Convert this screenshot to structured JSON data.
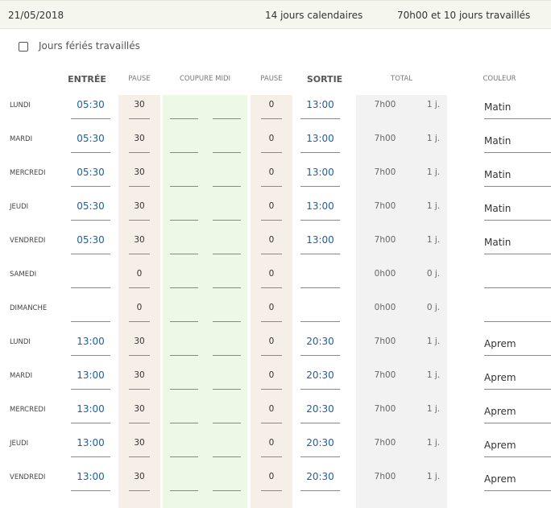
{
  "header": {
    "date": "21/05/2018",
    "calendar_days": "14 jours calendaires",
    "worked_summary": "70h00 et 10 jours travaillés"
  },
  "holidays_checkbox": {
    "label": "Jours fériés travaillés",
    "checked": false
  },
  "columns": {
    "entree": "ENTRÉE",
    "pause1": "PAUSE",
    "coupure": "COUPURE MIDI",
    "pause2": "PAUSE",
    "sortie": "SORTIE",
    "total": "TOTAL",
    "couleur": "COULEUR"
  },
  "colors": {
    "pause_band": "#f5efe7",
    "coupure_band": "#eef8e6",
    "total_band": "#f2f2f2",
    "time_blue": "#1e5fa0"
  },
  "rows": [
    {
      "day": "LUNDI",
      "entree": "05:30",
      "pause1": "30",
      "pause2": "0",
      "sortie": "13:00",
      "total": "7h00",
      "days": "1 j.",
      "couleur": "Matin"
    },
    {
      "day": "MARDI",
      "entree": "05:30",
      "pause1": "30",
      "pause2": "0",
      "sortie": "13:00",
      "total": "7h00",
      "days": "1 j.",
      "couleur": "Matin"
    },
    {
      "day": "MERCREDI",
      "entree": "05:30",
      "pause1": "30",
      "pause2": "0",
      "sortie": "13:00",
      "total": "7h00",
      "days": "1 j.",
      "couleur": "Matin"
    },
    {
      "day": "JEUDI",
      "entree": "05:30",
      "pause1": "30",
      "pause2": "0",
      "sortie": "13:00",
      "total": "7h00",
      "days": "1 j.",
      "couleur": "Matin"
    },
    {
      "day": "VENDREDI",
      "entree": "05:30",
      "pause1": "30",
      "pause2": "0",
      "sortie": "13:00",
      "total": "7h00",
      "days": "1 j.",
      "couleur": "Matin"
    },
    {
      "day": "SAMEDI",
      "entree": "",
      "pause1": "0",
      "pause2": "0",
      "sortie": "",
      "total": "0h00",
      "days": "0 j.",
      "couleur": ""
    },
    {
      "day": "DIMANCHE",
      "entree": "",
      "pause1": "0",
      "pause2": "0",
      "sortie": "",
      "total": "0h00",
      "days": "0 j.",
      "couleur": ""
    },
    {
      "day": "LUNDI",
      "entree": "13:00",
      "pause1": "30",
      "pause2": "0",
      "sortie": "20:30",
      "total": "7h00",
      "days": "1 j.",
      "couleur": "Aprem"
    },
    {
      "day": "MARDI",
      "entree": "13:00",
      "pause1": "30",
      "pause2": "0",
      "sortie": "20:30",
      "total": "7h00",
      "days": "1 j.",
      "couleur": "Aprem"
    },
    {
      "day": "MERCREDI",
      "entree": "13:00",
      "pause1": "30",
      "pause2": "0",
      "sortie": "20:30",
      "total": "7h00",
      "days": "1 j.",
      "couleur": "Aprem"
    },
    {
      "day": "JEUDI",
      "entree": "13:00",
      "pause1": "30",
      "pause2": "0",
      "sortie": "20:30",
      "total": "7h00",
      "days": "1 j.",
      "couleur": "Aprem"
    },
    {
      "day": "VENDREDI",
      "entree": "13:00",
      "pause1": "30",
      "pause2": "0",
      "sortie": "20:30",
      "total": "7h00",
      "days": "1 j.",
      "couleur": "Aprem"
    }
  ]
}
